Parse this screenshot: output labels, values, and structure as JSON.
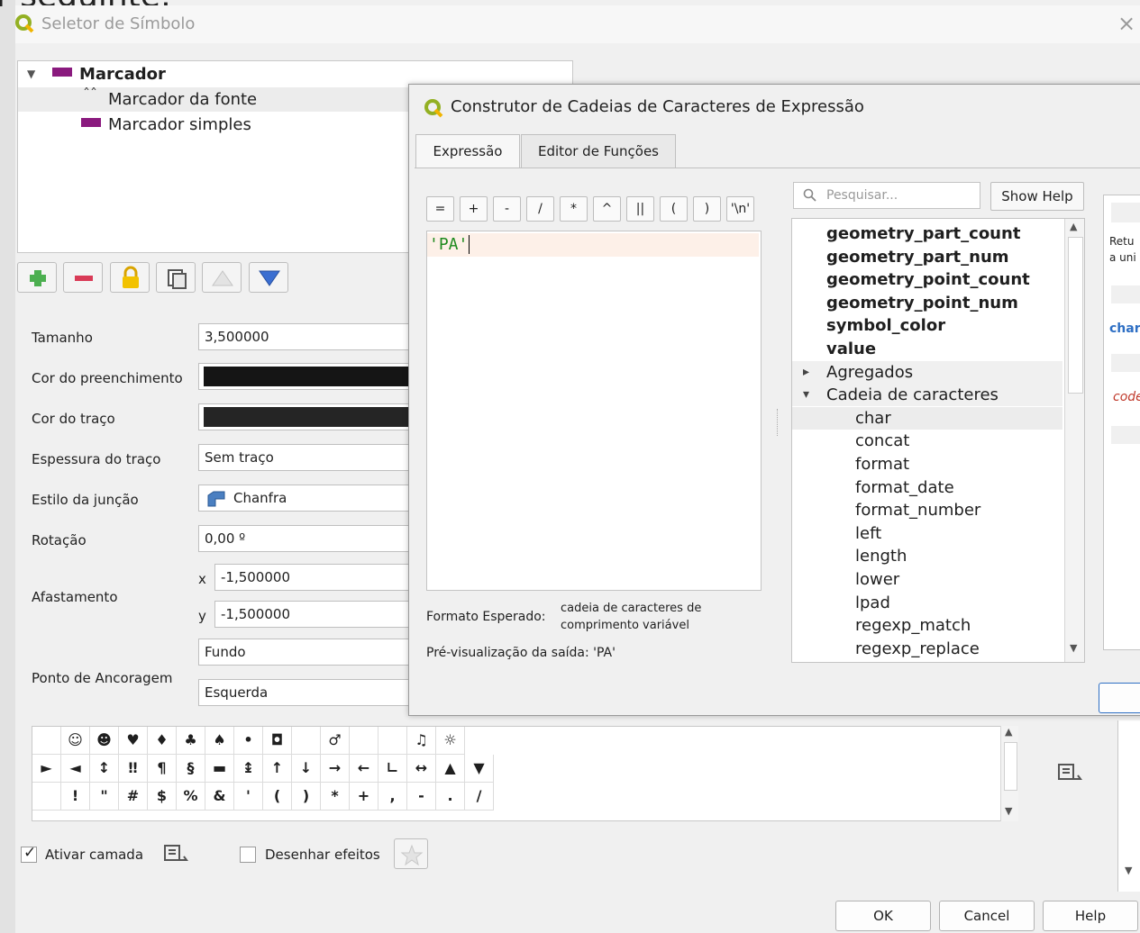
{
  "cut_text": "r seguinte:",
  "bg_dialog": {
    "title": "Seletor de Símbolo",
    "close_glyph": "×",
    "tree": {
      "root_label": "Marcador",
      "children": [
        {
          "label": "Marcador da fonte",
          "icon": "font-marker-icon",
          "icon_glyph": "ˆˆ"
        },
        {
          "label": "Marcador simples",
          "icon": "simple-marker-icon"
        }
      ]
    },
    "properties": {
      "size": {
        "label": "Tamanho",
        "value": "3,500000"
      },
      "fill_color": {
        "label": "Cor do preenchimento"
      },
      "stroke_color": {
        "label": "Cor do traço"
      },
      "stroke_width": {
        "label": "Espessura do traço",
        "value": "Sem traço"
      },
      "join_style": {
        "label": "Estilo da junção",
        "value": "Chanfra"
      },
      "rotation": {
        "label": "Rotação",
        "value": "0,00 º"
      },
      "offset": {
        "label": "Afastamento",
        "x_label": "x",
        "x_value": "-1,500000",
        "y_label": "y",
        "y_value": "-1,500000"
      },
      "anchor": {
        "label": "Ponto de Ancoragem",
        "vertical": "Fundo",
        "horizontal": "Esquerda"
      }
    },
    "symbol_grid": {
      "rows": [
        [
          "",
          "☺",
          "☻",
          "♥",
          "♦",
          "♣",
          "♠",
          "•",
          "◘",
          "",
          "♂",
          "",
          "",
          "♫",
          "☼"
        ],
        [
          "►",
          "◄",
          "↕",
          "‼",
          "¶",
          "§",
          "▬",
          "↨",
          "↑",
          "↓",
          "→",
          "←",
          "∟",
          "↔",
          "▲",
          "▼"
        ],
        [
          "",
          "!",
          "\"",
          "#",
          "$",
          "%",
          "&",
          "'",
          "(",
          ")",
          "*",
          "+",
          ",",
          "-",
          ".",
          "/"
        ]
      ]
    },
    "enable_layer": {
      "label": "Ativar camada",
      "checked": true,
      "check_glyph": "✓"
    },
    "draw_effects": {
      "label": "Desenhar efeitos",
      "checked": false
    },
    "buttons": {
      "ok": "OK",
      "cancel": "Cancel",
      "help": "Help"
    }
  },
  "expr_builder": {
    "title": "Construtor de Cadeias de Caracteres de Expressão",
    "tabs": [
      {
        "label": "Expressão",
        "active": true
      },
      {
        "label": "Editor de Funções",
        "active": false
      }
    ],
    "operators": [
      "=",
      "+",
      "-",
      "/",
      "*",
      "^",
      "||",
      "(",
      ")",
      "'\\n'"
    ],
    "expression": "'PA'",
    "expected_format_label": "Formato Esperado:",
    "expected_format_value_1": "cadeia de caracteres de",
    "expected_format_value_2": "comprimento variável",
    "preview_label": "Pré-visualização da saída: 'PA'",
    "search_placeholder": "Pesquisar...",
    "show_help": "Show Help",
    "functions": [
      {
        "label": "geometry_part_count",
        "kind": "bold"
      },
      {
        "label": "geometry_part_num",
        "kind": "bold"
      },
      {
        "label": "geometry_point_count",
        "kind": "bold"
      },
      {
        "label": "geometry_point_num",
        "kind": "bold"
      },
      {
        "label": "symbol_color",
        "kind": "bold"
      },
      {
        "label": "value",
        "kind": "bold"
      },
      {
        "label": "Agregados",
        "kind": "group",
        "expanded": false
      },
      {
        "label": "Cadeia de caracteres",
        "kind": "group",
        "expanded": true
      },
      {
        "label": "char",
        "kind": "sub",
        "selected": true
      },
      {
        "label": "concat",
        "kind": "sub"
      },
      {
        "label": "format",
        "kind": "sub"
      },
      {
        "label": "format_date",
        "kind": "sub"
      },
      {
        "label": "format_number",
        "kind": "sub"
      },
      {
        "label": "left",
        "kind": "sub"
      },
      {
        "label": "length",
        "kind": "sub"
      },
      {
        "label": "lower",
        "kind": "sub"
      },
      {
        "label": "lpad",
        "kind": "sub"
      },
      {
        "label": "regexp_match",
        "kind": "sub"
      },
      {
        "label": "regexp_replace",
        "kind": "sub"
      }
    ],
    "help_fragments": {
      "line1": "Retu",
      "line2": "a uni",
      "func": "char",
      "code": "code"
    },
    "colors": {
      "accent": "#2e6fc4",
      "code": "#c0392b",
      "string": "#1e8a1e"
    }
  }
}
